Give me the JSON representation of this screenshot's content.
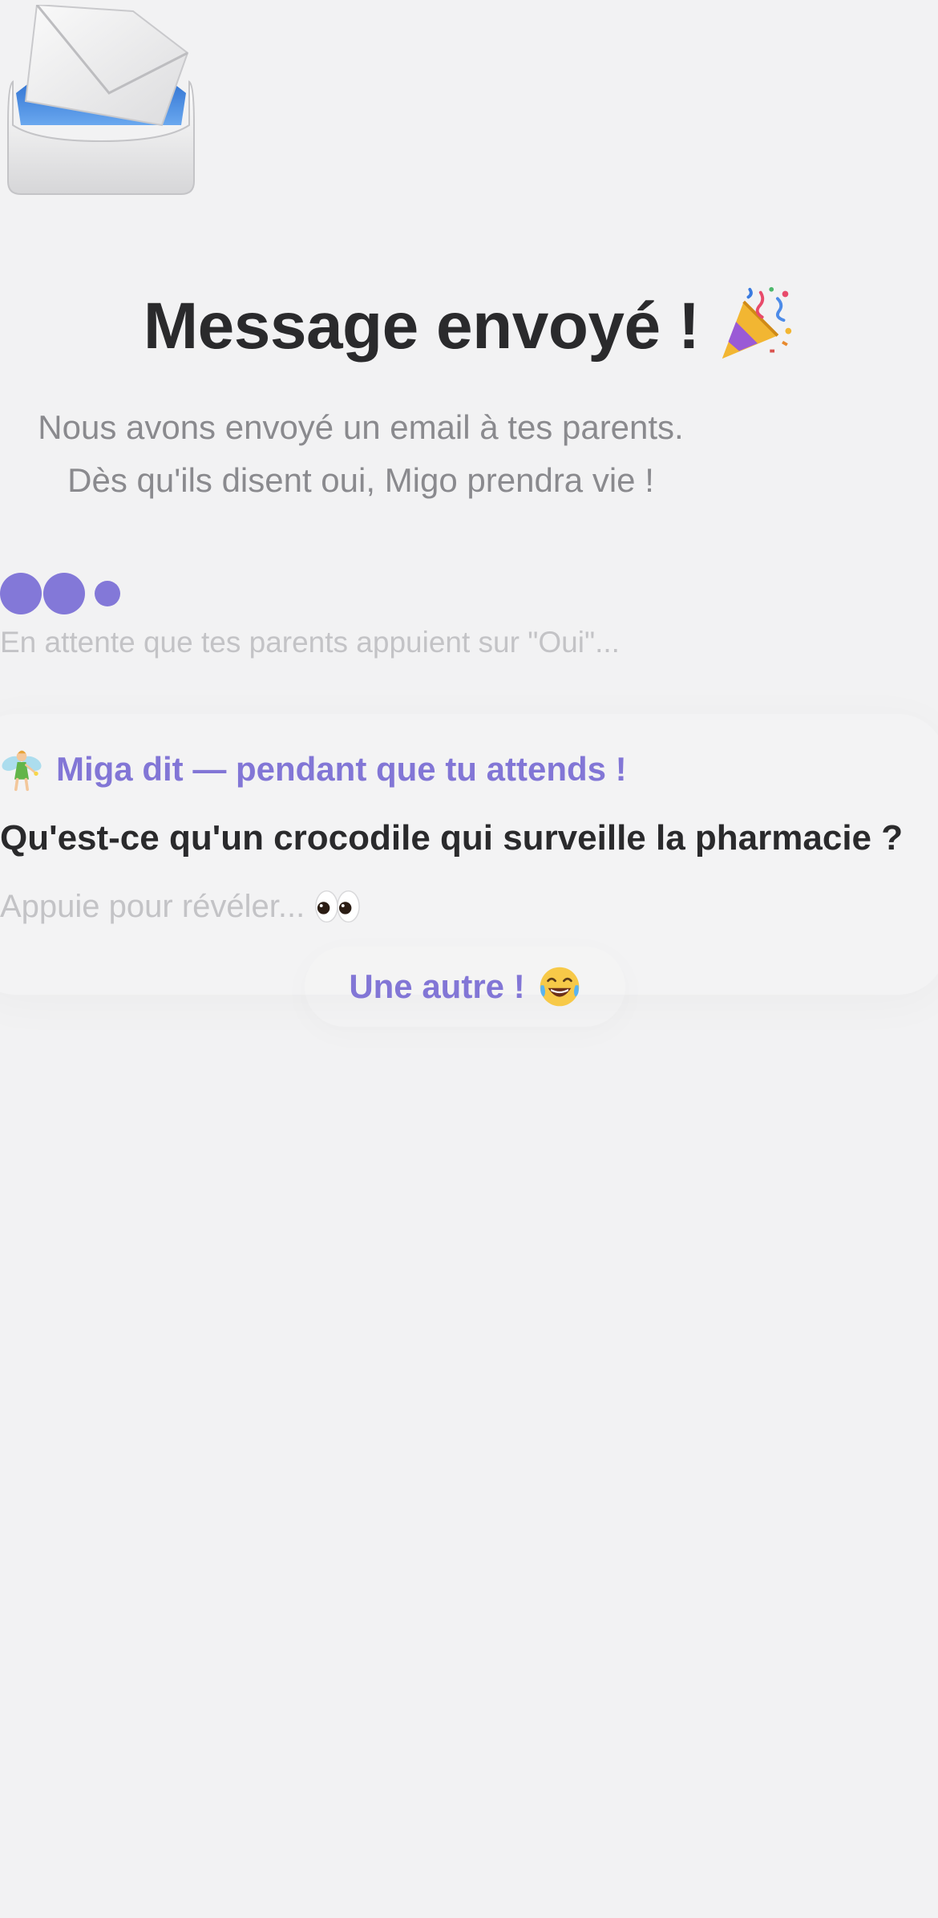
{
  "header": {
    "title": "Message envoyé !",
    "title_icon": "party-popper-icon",
    "top_icon": "inbox-tray-envelope-icon"
  },
  "message": {
    "line1": "Nous avons envoyé un email à tes parents.",
    "line2": "Dès qu'ils disent oui, Migo prendra vie !"
  },
  "status": {
    "waiting_text": "En attente que tes parents appuient sur \"Oui\"...",
    "dot_color": "#8378d8"
  },
  "joke": {
    "header_icon": "fairy-icon",
    "header_text": "Miga dit — pendant que tu attends !",
    "question": "Qu'est-ce qu'un crocodile qui surveille la pharmacie ?",
    "reveal_text": "Appuie pour révéler...",
    "reveal_icon": "eyes-icon"
  },
  "actions": {
    "another_label": "Une autre !",
    "another_icon": "laughing-face-icon"
  },
  "colors": {
    "background": "#f2f2f3",
    "accent": "#8276d6",
    "title": "#2a2a2c",
    "muted": "#8a8a8e",
    "faint": "#c3c3c6"
  }
}
